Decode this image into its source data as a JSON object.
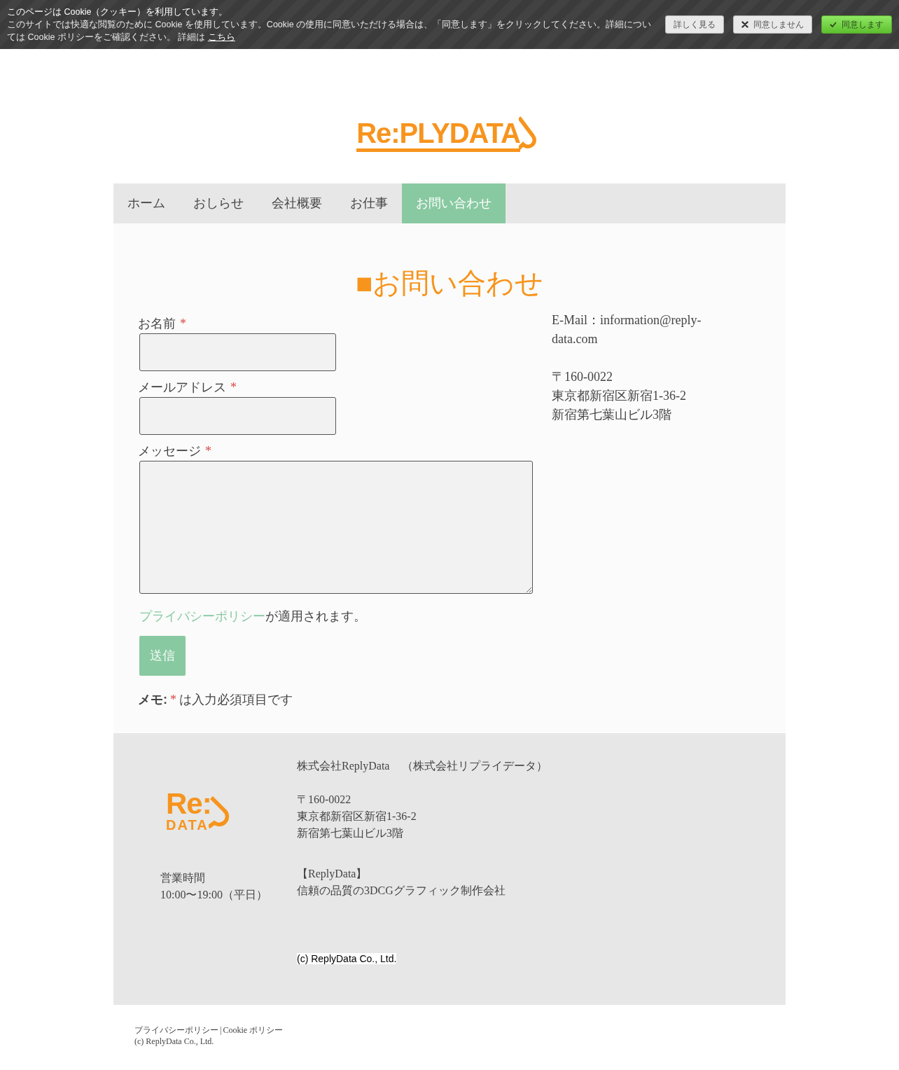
{
  "cookie_banner": {
    "title": "このページは Cookie（クッキー）を利用しています。",
    "message": "このサイトでは快適な閲覧のために Cookie を使用しています。Cookie の使用に同意いただける場合は、「同意します」をクリックしてください。詳細については Cookie ポリシーをご確認ください。 詳細は",
    "link": "こちら",
    "buttons": [
      {
        "label": "詳しく見る",
        "kind": "more"
      },
      {
        "label": "同意しません",
        "kind": "decline"
      },
      {
        "label": "同意します",
        "kind": "accept"
      }
    ]
  },
  "header": {
    "logo": "Re:PLYDATA"
  },
  "nav": {
    "items": [
      {
        "label": "ホーム",
        "selected": false
      },
      {
        "label": "おしらせ",
        "selected": false
      },
      {
        "label": "会社概要",
        "selected": false
      },
      {
        "label": "お仕事",
        "selected": false
      },
      {
        "label": "お問い合わせ",
        "selected": true
      }
    ]
  },
  "contact": {
    "heading": "■お問い合わせ",
    "fields": [
      {
        "label": "お名前",
        "required_mark": "*",
        "kind": "input"
      },
      {
        "label": "メールアドレス",
        "required_mark": "*",
        "kind": "input"
      },
      {
        "label": "メッセージ",
        "required_mark": "*",
        "kind": "textarea"
      }
    ],
    "privacy_link": "プライバシーポリシー",
    "privacy_note": "が適用されます。",
    "submit": "送信",
    "note_label": "メモ:",
    "note_mark": "*",
    "note_text": "は入力必須項目です"
  },
  "contact_info": {
    "email": "E-Mail：information@reply-data.com",
    "address": [
      "〒160-0022",
      "東京都新宿区新宿1-36-2",
      "新宿第七葉山ビル3階"
    ]
  },
  "footer": {
    "logo_top": "Re:",
    "logo_bottom": "DATA",
    "hours_label": "営業時間",
    "hours": "10:00〜19:00（平日）",
    "company_name": "株式会社ReplyData",
    "company_kana": "（株式会社リプライデータ）",
    "address": [
      "〒160-0022",
      "東京都新宿区新宿1-36-2",
      "新宿第七葉山ビル3階"
    ],
    "tagline_title": "【ReplyData】",
    "tagline": "信頼の品質の3DCGグラフィック制作会社",
    "copyright": "(c) ReplyData Co., Ltd."
  },
  "bottom_bar": {
    "links": [
      "プライバシーポリシー",
      "Cookie ポリシー"
    ],
    "separator": "|",
    "copyright": "(c) ReplyData Co., Ltd."
  }
}
